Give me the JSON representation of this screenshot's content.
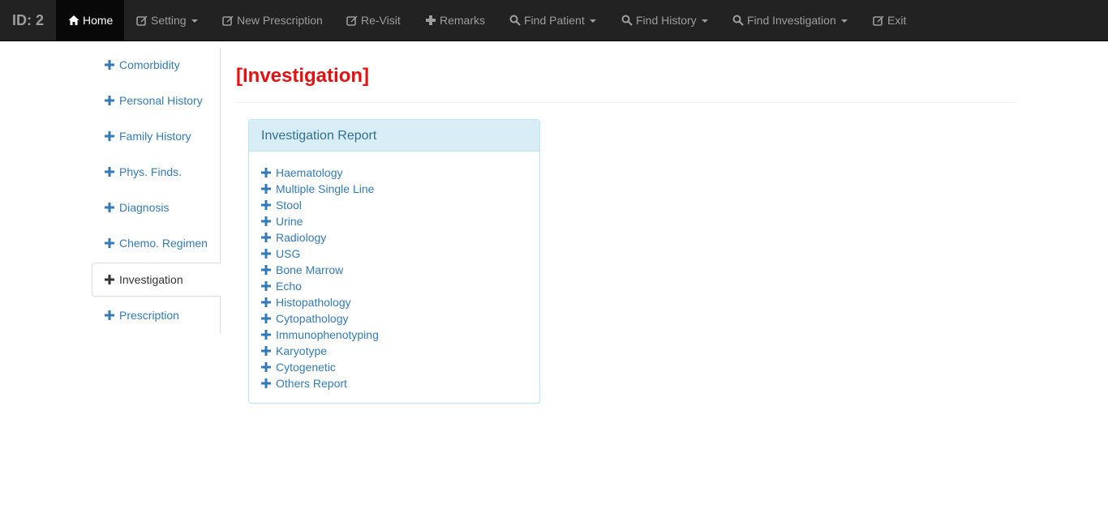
{
  "navbar": {
    "brand": "ID: 2",
    "items": [
      {
        "label": "Home",
        "icon": "home-icon",
        "active": true
      },
      {
        "label": "Setting",
        "icon": "edit-icon",
        "dropdown": true
      },
      {
        "label": "New Prescription",
        "icon": "edit-icon"
      },
      {
        "label": "Re-Visit",
        "icon": "edit-icon"
      },
      {
        "label": "Remarks",
        "icon": "plus-icon"
      },
      {
        "label": "Find Patient",
        "icon": "search-icon",
        "dropdown": true
      },
      {
        "label": "Find History",
        "icon": "search-icon",
        "dropdown": true
      },
      {
        "label": "Find Investigation",
        "icon": "search-icon",
        "dropdown": true
      },
      {
        "label": "Exit",
        "icon": "edit-icon"
      }
    ]
  },
  "sidebar": {
    "items": [
      {
        "label": "Comorbidity"
      },
      {
        "label": "Personal History"
      },
      {
        "label": "Family History"
      },
      {
        "label": "Phys. Finds."
      },
      {
        "label": "Diagnosis"
      },
      {
        "label": "Chemo. Regimen"
      },
      {
        "label": "Investigation",
        "active": true
      },
      {
        "label": "Prescription"
      }
    ]
  },
  "main": {
    "title": "[Investigation]",
    "panel": {
      "heading": "Investigation Report",
      "items": [
        "Haematology",
        "Multiple Single Line",
        "Stool",
        "Urine",
        "Radiology",
        "USG",
        "Bone Marrow",
        "Echo",
        "Histopathology",
        "Cytopathology",
        "Immunophenotyping",
        "Karyotype",
        "Cytogenetic",
        "Others Report"
      ]
    }
  },
  "colors": {
    "navbar_bg": "#222222",
    "nav_text": "#9d9d9d",
    "link": "#337ab7",
    "title_red": "#e3110f",
    "panel_heading_bg": "#d9edf7",
    "panel_heading_text": "#31708f"
  }
}
